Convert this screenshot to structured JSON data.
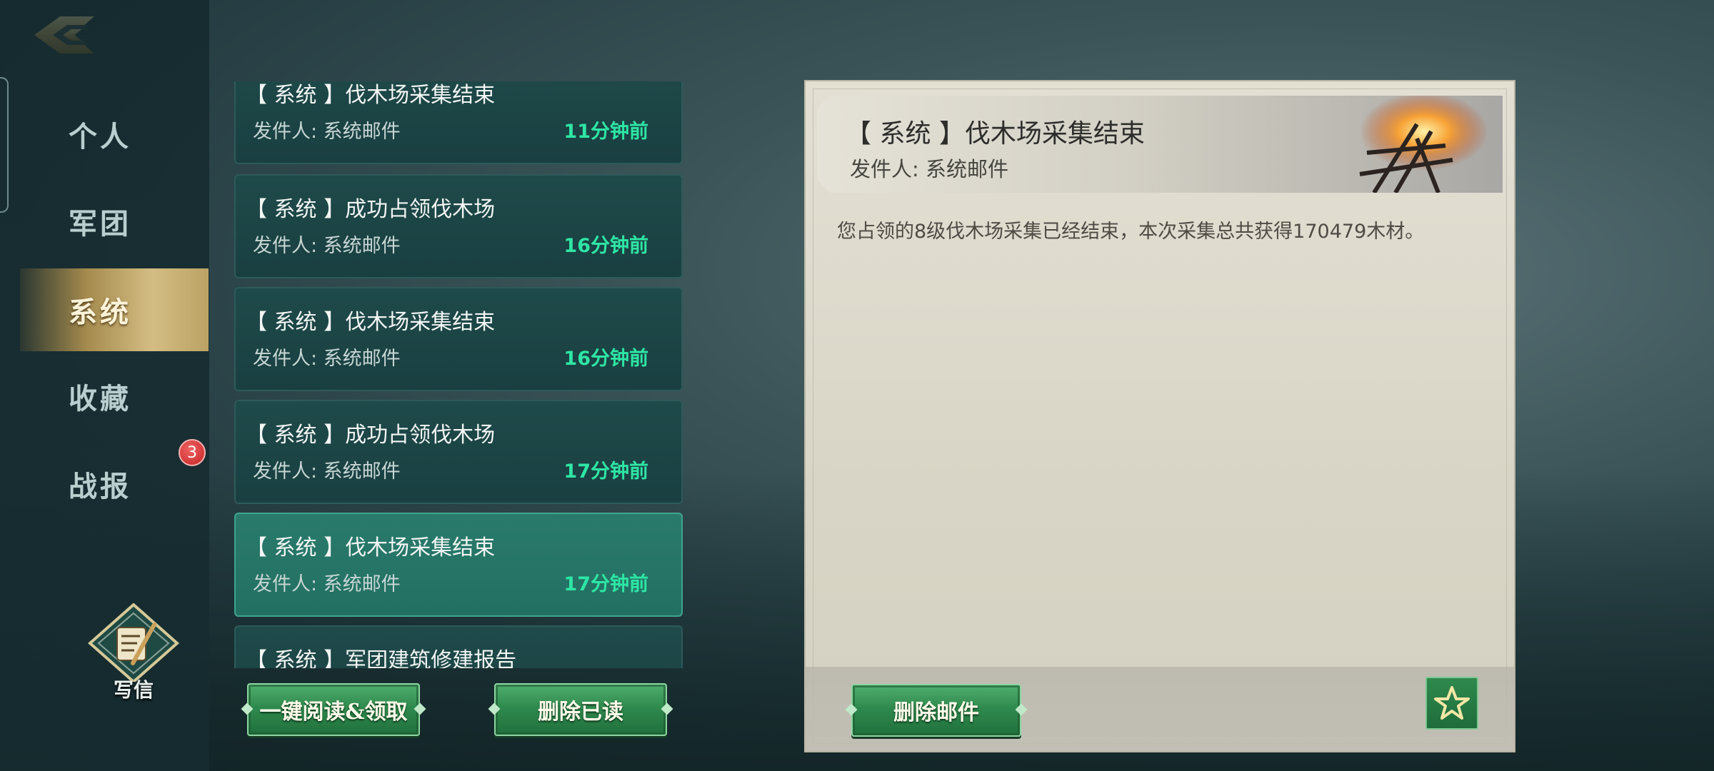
{
  "nav": {
    "back_icon": "back-arrow-icon",
    "tabs": [
      {
        "label": "个人"
      },
      {
        "label": "军团"
      },
      {
        "label": "系统"
      },
      {
        "label": "收藏"
      },
      {
        "label": "战报"
      }
    ],
    "active_tab": "系统",
    "battle_report_badge": "3",
    "write_label": "写信"
  },
  "mail_list": {
    "items": [
      {
        "title": "【 系统 】伐木场采集结束",
        "sender": "发件人: 系统邮件",
        "time": "11分钟前"
      },
      {
        "title": "【 系统 】成功占领伐木场",
        "sender": "发件人: 系统邮件",
        "time": "16分钟前"
      },
      {
        "title": "【 系统 】伐木场采集结束",
        "sender": "发件人: 系统邮件",
        "time": "16分钟前"
      },
      {
        "title": "【 系统 】成功占领伐木场",
        "sender": "发件人: 系统邮件",
        "time": "17分钟前"
      },
      {
        "title": "【 系统 】伐木场采集结束",
        "sender": "发件人: 系统邮件",
        "time": "17分钟前"
      },
      {
        "title": "【 系统 】军团建筑修建报告",
        "sender": "",
        "time": ""
      }
    ],
    "selected_index": 4,
    "read_all_label": "一键阅读&领取",
    "delete_read_label": "删除已读"
  },
  "detail": {
    "title": "【 系统 】伐木场采集结束",
    "sender": "发件人: 系统邮件",
    "body": "您占领的8级伐木场采集已经结束，本次采集总共获得170479木材。",
    "delete_label": "删除邮件",
    "favorite_icon": "star-icon"
  },
  "colors": {
    "accent_green": "#2ee6a5",
    "active_tab_gold": "#d4bd83",
    "badge_red": "#c52222"
  }
}
